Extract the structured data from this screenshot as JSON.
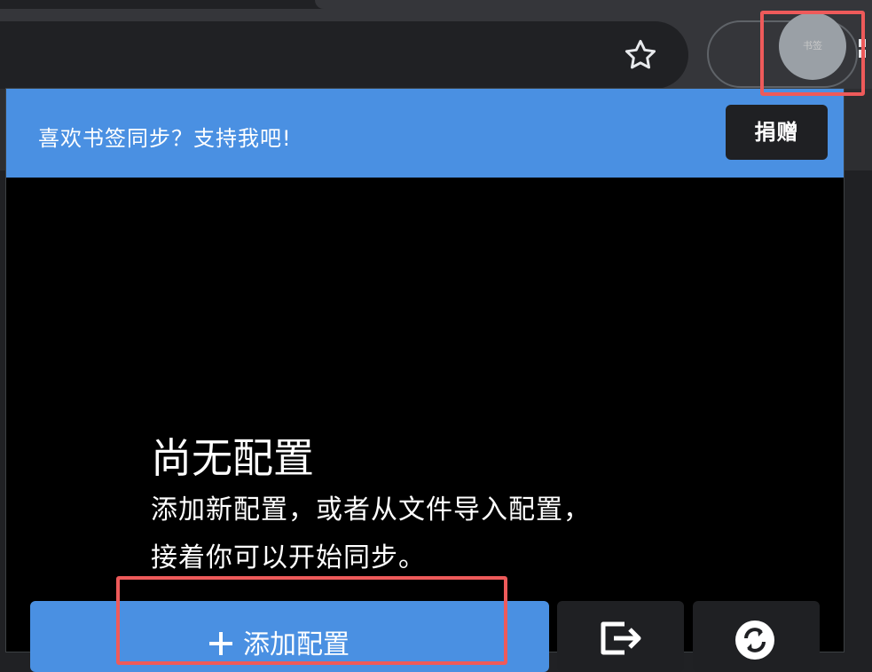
{
  "browser": {
    "bookmark_icon": "star-icon",
    "extension_avatar_text": "书签"
  },
  "popup": {
    "banner": {
      "text": "喜欢书签同步？支持我吧!",
      "donate_label": "捐赠"
    },
    "empty_state": {
      "title": "尚无配置",
      "description": "添加新配置，或者从文件导入配置，\n接着你可以开始同步。"
    },
    "actions": {
      "add_label": "添加配置",
      "add_icon": "plus-icon",
      "import_icon": "import-icon",
      "sync_icon": "sync-icon"
    },
    "colors": {
      "accent": "#4a90e2",
      "highlight": "#ee5a5a",
      "dark_button": "#1f2023"
    }
  }
}
